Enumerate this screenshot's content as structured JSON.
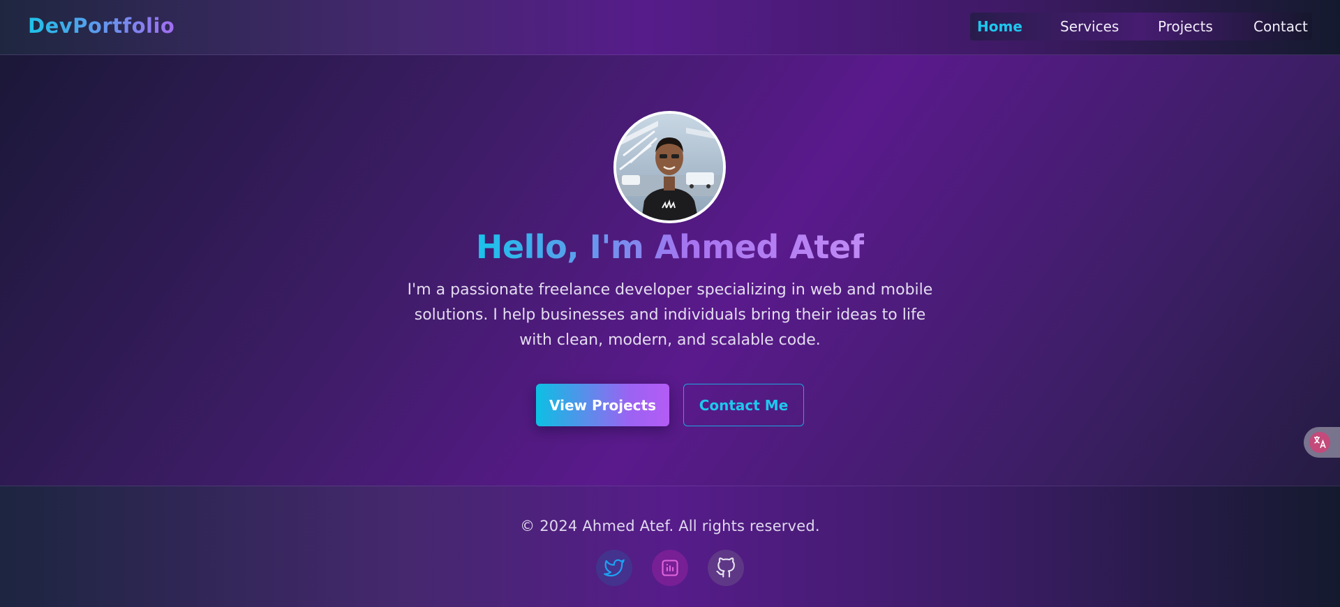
{
  "header": {
    "logo": "DevPortfolio",
    "nav": [
      {
        "label": "Home",
        "active": true
      },
      {
        "label": "Services",
        "active": false
      },
      {
        "label": "Projects",
        "active": false
      },
      {
        "label": "Contact",
        "active": false
      }
    ]
  },
  "hero": {
    "avatar_icon": "profile-photo",
    "title": "Hello, I'm Ahmed Atef",
    "description": "I'm a passionate freelance developer specializing in web and mobile solutions. I help businesses and individuals bring their ideas to life with clean, modern, and scalable code.",
    "primary_button": "View Projects",
    "secondary_button": "Contact Me"
  },
  "translate_widget": {
    "icon": "translate-icon"
  },
  "footer": {
    "copyright": "© 2024 Ahmed Atef. All rights reserved.",
    "social": [
      {
        "icon": "twitter-icon"
      },
      {
        "icon": "dribbble-icon"
      },
      {
        "icon": "github-icon"
      }
    ]
  },
  "colors": {
    "accent_cyan": "#1ec8ee",
    "accent_purple": "#a774f0",
    "background_purple": "#5a1a8c",
    "twitter_blue": "#1da1f2",
    "dribbble_pink": "#d94fd0"
  }
}
